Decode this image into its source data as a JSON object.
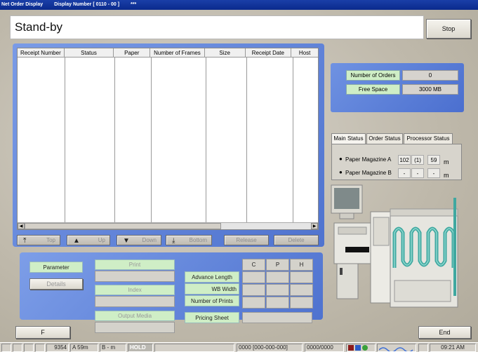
{
  "titlebar": {
    "app_title": "Net Order Display",
    "display_number": "Display Number [ 0110 - 00 ]",
    "stars": "***"
  },
  "header": {
    "status_text": "Stand-by",
    "stop_label": "Stop"
  },
  "table": {
    "columns": [
      "Receipt Number",
      "Status",
      "Paper",
      "Number of Frames",
      "Size",
      "Receipt Date",
      "Host"
    ],
    "rows": []
  },
  "nav": {
    "top": "Top",
    "up": "Up",
    "down": "Down",
    "bottom": "Bottom",
    "release": "Release",
    "delete": "Delete"
  },
  "lower": {
    "parameter": "Parameter",
    "details": "Details",
    "print": "Print",
    "index": "Index",
    "output_media": "Output Media",
    "grid_headers": [
      "C",
      "P",
      "H"
    ],
    "advance_length": "Advance Length",
    "wb_width": "WB Width",
    "number_of_prints": "Number of Prints",
    "pricing_sheet": "Pricing Sheet"
  },
  "info": {
    "orders_label": "Number of Orders",
    "orders_value": "0",
    "free_label": "Free Space",
    "free_value": "3000 MB"
  },
  "tabs": {
    "main_status": "Main Status",
    "order_status": "Order Status",
    "processor_status": "Processor Status"
  },
  "magazines": {
    "a_label": "Paper Magazine A",
    "a_values": [
      "102",
      "(1)",
      "59"
    ],
    "b_label": "Paper Magazine B",
    "b_values": [
      "-",
      "-",
      "-"
    ],
    "unit": "m"
  },
  "bottom": {
    "f_label": "F",
    "end_label": "End"
  },
  "statusbar": {
    "counter": "9354",
    "mag_a": "A 59m",
    "mag_b": "B - m",
    "hold": "HOLD",
    "order_code": "0000 [000-000-000]",
    "ratio": "0000/0000",
    "time": "09:21 AM"
  },
  "colors": {
    "title_blue": "#0a2a8c",
    "panel_blue": "#5a7ed8",
    "label_green": "#cfeec6",
    "machine_teal": "#3fa8a0"
  }
}
